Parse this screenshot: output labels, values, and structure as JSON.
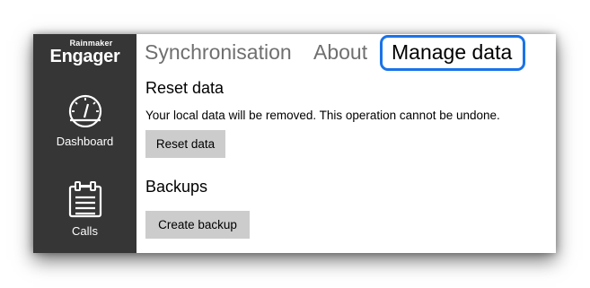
{
  "brand": {
    "top": "Rainmaker",
    "name": "Engager"
  },
  "sidebar": {
    "items": [
      {
        "label": "Dashboard",
        "icon": "speedometer-icon"
      },
      {
        "label": "Calls",
        "icon": "calendar-icon"
      }
    ]
  },
  "tabs": [
    {
      "label": "Synchronisation",
      "selected": false
    },
    {
      "label": "About",
      "selected": false
    },
    {
      "label": "Manage data",
      "selected": true
    }
  ],
  "reset": {
    "title": "Reset data",
    "description": "Your local data will be removed. This operation cannot be undone.",
    "button_label": "Reset data"
  },
  "backups": {
    "title": "Backups",
    "button_label": "Create backup"
  },
  "colors": {
    "sidebar_bg": "#363636",
    "highlight_border": "#1a73e8",
    "button_bg": "#cccccc"
  }
}
